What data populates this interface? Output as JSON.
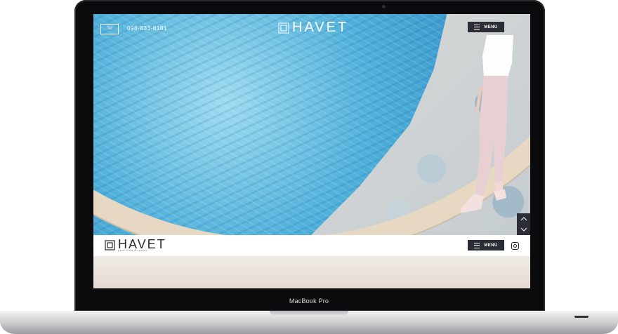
{
  "device": {
    "brand_label": "MacBook Pro"
  },
  "hero": {
    "phone_badge": "Tel",
    "phone_number": "098-833-8181",
    "logo_text": "HAVET",
    "menu_label": "MENU"
  },
  "header": {
    "logo_text": "HAVET",
    "logo_tagline": "pool villa & resort",
    "menu_label": "MENU"
  },
  "icons": {
    "instagram": "instagram-icon",
    "scroll_up": "chevron-up-icon",
    "scroll_down": "chevron-down-icon"
  },
  "colors": {
    "menu_button": "#2a2d36",
    "pool_blue": "#4fb0da",
    "header_bg": "#ffffff"
  }
}
